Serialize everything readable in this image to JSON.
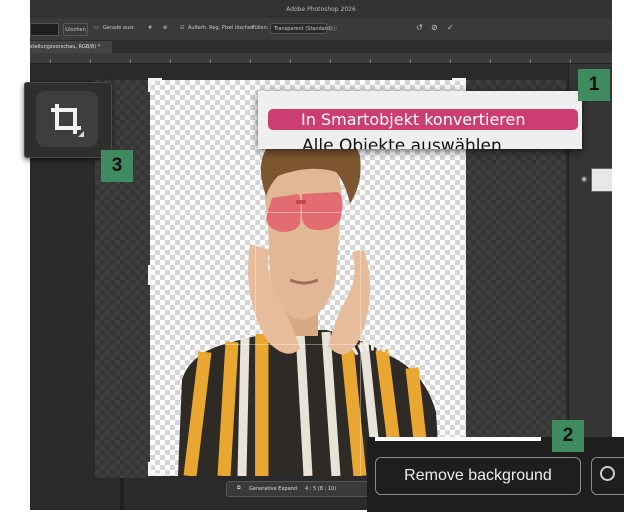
{
  "app": {
    "title": "Adobe Photoshop 2026"
  },
  "options_bar": {
    "delete_label": "Löschen",
    "straighten_label": "Gerade ausr.",
    "delete_cropped_label": "Außerh. Reg. Pixel löschen",
    "fill_label": "Füllen:",
    "fill_value": "Transparent (Standard)"
  },
  "document_tab": {
    "label": "stellungsvorschau, RGB/8) *"
  },
  "context_menu": {
    "highlighted_item": "In Smartobjekt konvertieren",
    "next_item_partial": "Alle Objekte auswählen"
  },
  "contextual_taskbar": {
    "generative_expand_label": "Generative Expand",
    "ratio_value": "4 : 5 (8 : 10)"
  },
  "remove_background_button": {
    "label": "Remove background"
  },
  "callouts": {
    "one": "1",
    "two": "2",
    "three": "3"
  },
  "colors": {
    "badge": "#3f8a5f",
    "menu_highlight": "#cc3d72",
    "panel_dark": "#1e1e1e"
  }
}
